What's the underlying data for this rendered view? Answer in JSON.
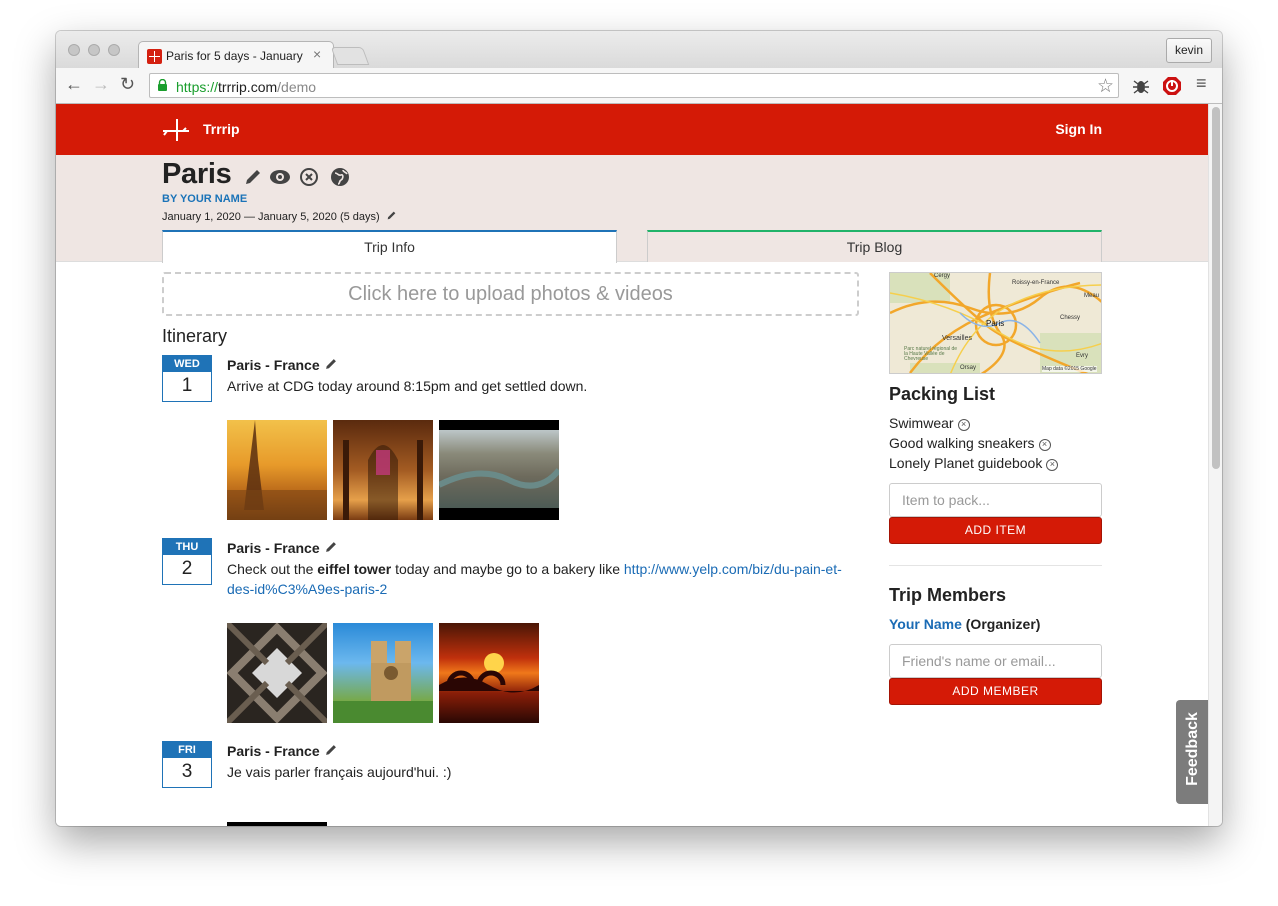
{
  "browser": {
    "tab_title": "Paris for 5 days - January",
    "url_scheme": "https://",
    "url_host": "trrrip.com",
    "url_path": "/demo",
    "user_label": "kevin"
  },
  "site": {
    "brand": "Trrrip",
    "sign_in": "Sign In",
    "accent_color": "#d41a06"
  },
  "trip": {
    "title": "Paris",
    "byline": "BY YOUR NAME",
    "dates": "January 1, 2020 — January 5, 2020 (5 days)",
    "tabs": [
      "Trip Info",
      "Trip Blog"
    ],
    "upload_prompt": "Click here to upload photos & videos",
    "itinerary_heading": "Itinerary"
  },
  "itinerary": [
    {
      "weekday": "WED",
      "day": "1",
      "place": "Paris - France",
      "note": "Arrive at CDG today around 8:15pm and get settled down."
    },
    {
      "weekday": "THU",
      "day": "2",
      "place": "Paris - France",
      "note_before": "Check out the ",
      "note_bold": "eiffel tower",
      "note_after": " today and maybe go to a bakery like ",
      "note_link": "http://www.yelp.com/biz/du-pain-et-des-id%C3%A9es-paris-2"
    },
    {
      "weekday": "FRI",
      "day": "3",
      "place": "Paris - France",
      "note": "Je vais parler français aujourd'hui. :)"
    }
  ],
  "map": {
    "labels": [
      "Cergy",
      "Roissy-en-France",
      "Meau",
      "Paris",
      "Versailles",
      "Chessy",
      "Parc naturel régional de la Haute Vallée de Chevreuse",
      "Map data ©2015 Google",
      "Orsay",
      "Evry"
    ]
  },
  "packing": {
    "heading": "Packing List",
    "items": [
      "Swimwear",
      "Good walking sneakers",
      "Lonely Planet guidebook"
    ],
    "placeholder": "Item to pack...",
    "button": "ADD ITEM"
  },
  "members": {
    "heading": "Trip Members",
    "name": "Your Name",
    "role": " (Organizer)",
    "placeholder": "Friend's name or email...",
    "button": "ADD MEMBER"
  },
  "feedback": "Feedback"
}
